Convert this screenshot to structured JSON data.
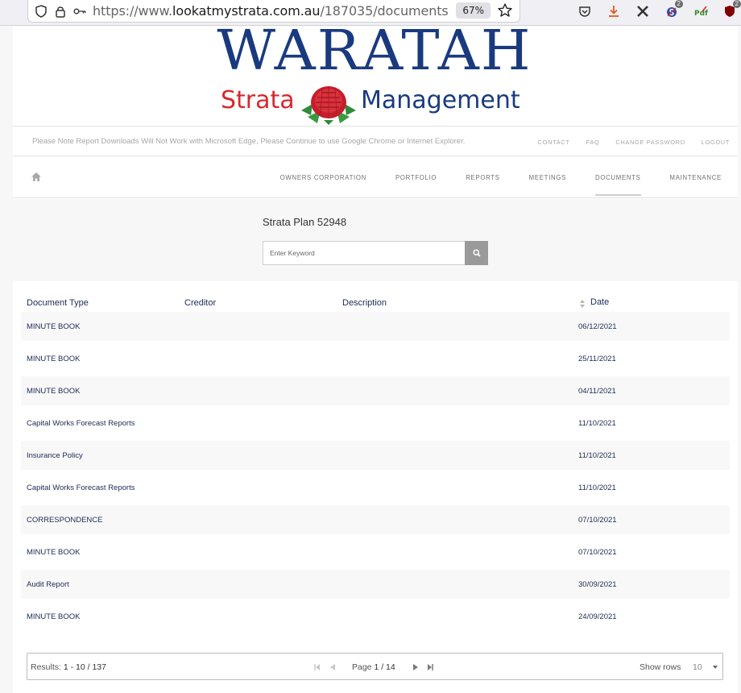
{
  "browser": {
    "url_prefix": "https://www.",
    "url_host": "lookatmystrata.com.au",
    "url_path": "/187035/documents",
    "zoom": "67%",
    "badge_1": "2",
    "badge_2": "2"
  },
  "logo": {
    "title": "WARATAH",
    "sub_left": "Strata",
    "sub_right": "Management"
  },
  "notice": "Please Note Report Downloads Will Not Work with Microsoft Edge, Please Continue to use Google Chrome or Internet Explorer.",
  "top_links": [
    "CONTACT",
    "FAQ",
    "CHANGE PASSWORD",
    "LOGOUT"
  ],
  "nav": {
    "items": [
      "OWNERS CORPORATION",
      "PORTFOLIO",
      "REPORTS",
      "MEETINGS",
      "DOCUMENTS",
      "MAINTENANCE"
    ],
    "active": "DOCUMENTS"
  },
  "search": {
    "plan_title": "Strata Plan 52948",
    "placeholder": "Enter Keyword"
  },
  "table": {
    "headers": {
      "document_type": "Document Type",
      "creditor": "Creditor",
      "description": "Description",
      "date": "Date"
    },
    "rows": [
      {
        "type": "MINUTE BOOK",
        "creditor": "",
        "description": "",
        "date": "06/12/2021"
      },
      {
        "type": "MINUTE BOOK",
        "creditor": "",
        "description": "",
        "date": "25/11/2021"
      },
      {
        "type": "MINUTE BOOK",
        "creditor": "",
        "description": "",
        "date": "04/11/2021"
      },
      {
        "type": "Capital Works Forecast Reports",
        "creditor": "",
        "description": "",
        "date": "11/10/2021"
      },
      {
        "type": "Insurance Policy",
        "creditor": "",
        "description": "",
        "date": "11/10/2021"
      },
      {
        "type": "Capital Works Forecast Reports",
        "creditor": "",
        "description": "",
        "date": "11/10/2021"
      },
      {
        "type": "CORRESPONDENCE",
        "creditor": "",
        "description": "",
        "date": "07/10/2021"
      },
      {
        "type": "MINUTE BOOK",
        "creditor": "",
        "description": "",
        "date": "07/10/2021"
      },
      {
        "type": "Audit Report",
        "creditor": "",
        "description": "",
        "date": "30/09/2021"
      },
      {
        "type": "MINUTE BOOK",
        "creditor": "",
        "description": "",
        "date": "24/09/2021"
      }
    ]
  },
  "pager": {
    "results_label": "Results:",
    "results_range": "1 - 10 / 137",
    "page_label": "Page",
    "page_value": "1 / 14",
    "show_rows_label": "Show rows",
    "rows_value": "10"
  }
}
